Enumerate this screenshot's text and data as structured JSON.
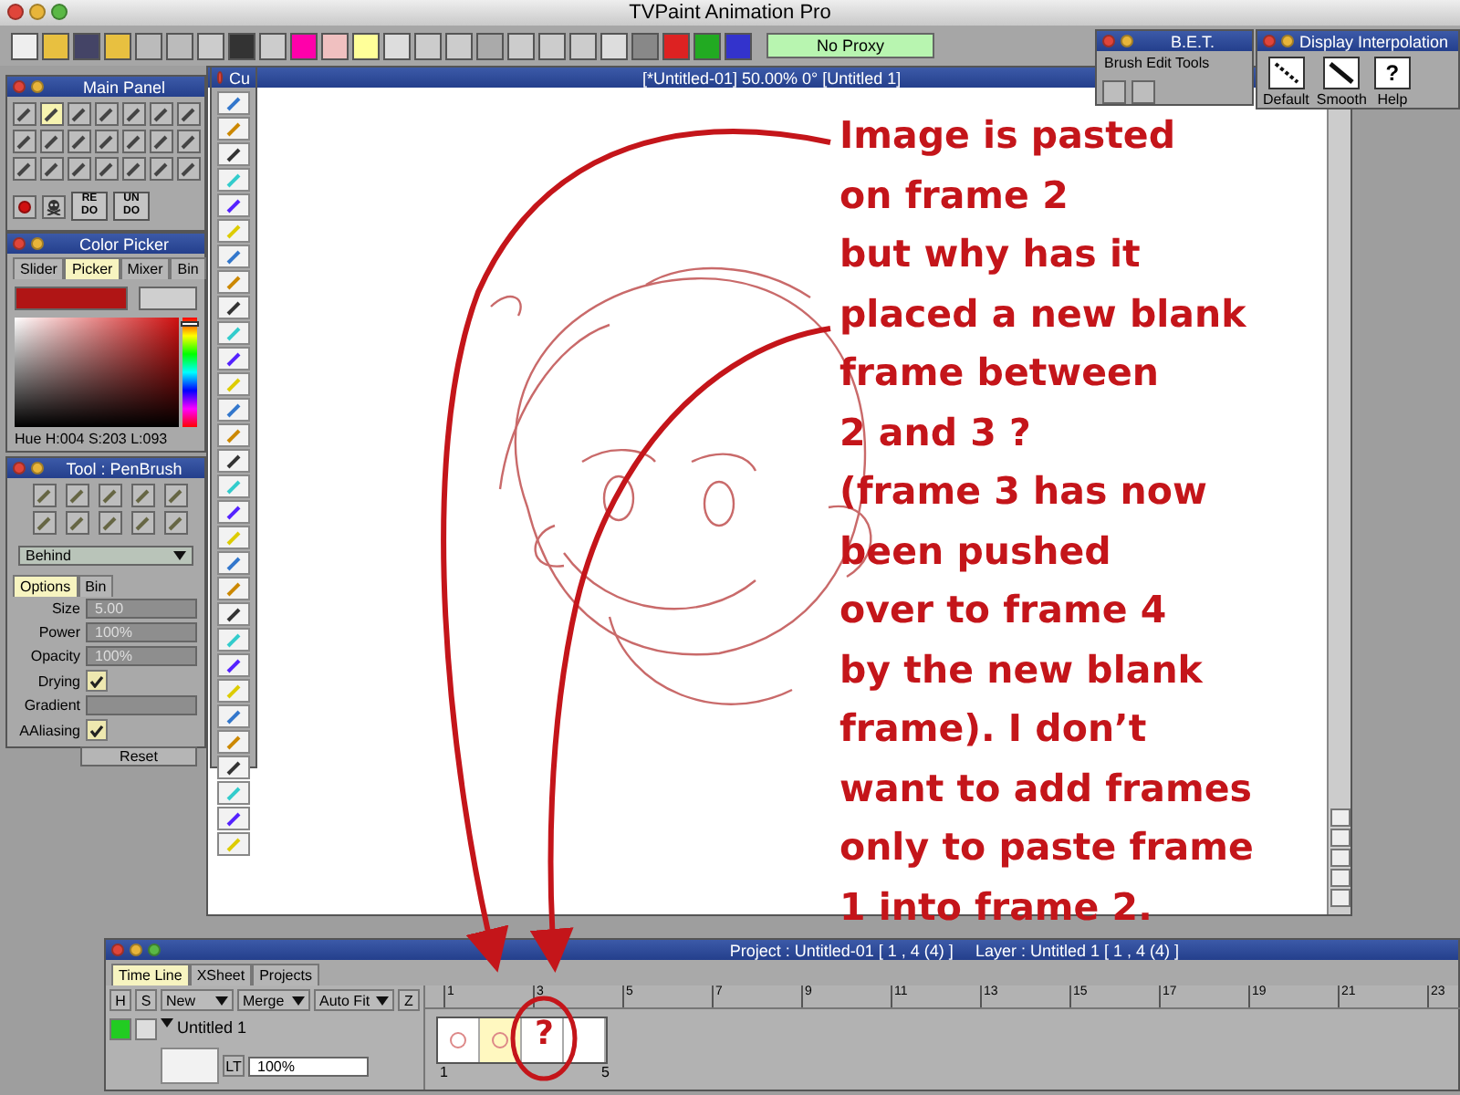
{
  "app_title": "TVPaint Animation Pro",
  "toolbar": {
    "proxy": "No Proxy"
  },
  "canvas_window": {
    "title": "[*Untitled-01]  50.00%  0°  [Untitled 1]"
  },
  "custom_panel": {
    "title": "Cu"
  },
  "main_panel": {
    "title": "Main Panel",
    "tools": [
      {
        "selected": false
      },
      {
        "selected": true
      },
      {
        "selected": false
      },
      {
        "selected": false
      },
      {
        "selected": false
      },
      {
        "selected": false
      },
      {
        "selected": false
      },
      {
        "selected": false
      },
      {
        "selected": false
      },
      {
        "selected": false
      },
      {
        "selected": false
      },
      {
        "selected": false
      },
      {
        "selected": false
      },
      {
        "selected": false
      },
      {
        "selected": false
      },
      {
        "selected": false
      },
      {
        "selected": false
      },
      {
        "selected": false
      },
      {
        "selected": false
      },
      {
        "selected": false
      },
      {
        "selected": false
      }
    ],
    "redo": "RE DO",
    "undo": "UN DO"
  },
  "color_picker": {
    "title": "Color Picker",
    "tabs": [
      {
        "label": "Slider",
        "selected": false
      },
      {
        "label": "Picker",
        "selected": true
      },
      {
        "label": "Mixer",
        "selected": false
      },
      {
        "label": "Bin",
        "selected": false
      }
    ],
    "readout": "Hue H:004 S:203 L:093",
    "hue": {
      "level": 0.03
    }
  },
  "tool_panel": {
    "title": "Tool : PenBrush",
    "mode": "Behind",
    "tabs": [
      {
        "label": "Options",
        "selected": true
      },
      {
        "label": "Bin",
        "selected": false
      }
    ],
    "settings": [
      {
        "kind": "field",
        "label": "Size",
        "value": "5.00"
      },
      {
        "kind": "field",
        "label": "Power",
        "value": "100%"
      },
      {
        "kind": "field",
        "label": "Opacity",
        "value": "100%"
      },
      {
        "kind": "check",
        "label": "Drying",
        "checked": true
      },
      {
        "kind": "bar",
        "label": "Gradient"
      },
      {
        "kind": "check",
        "label": "AAliasing",
        "checked": true
      }
    ],
    "reset": "Reset"
  },
  "bet_panel": {
    "title": "B.E.T.",
    "subtitle": "Brush Edit Tools"
  },
  "interpolation_panel": {
    "title": "Display Interpolation",
    "buttons": [
      {
        "label": "Default",
        "kind": "dashed"
      },
      {
        "label": "Smooth",
        "kind": "solid"
      },
      {
        "label": "Help",
        "kind": "help",
        "glyph": "?"
      }
    ]
  },
  "timeline": {
    "title": "Project : Untitled-01 [ 1 , 4  (4) ]",
    "layer_info": "Layer : Untitled 1 [ 1 , 4  (4) ]",
    "tabs": [
      {
        "label": "Time Line",
        "selected": true
      },
      {
        "label": "XSheet",
        "selected": false
      },
      {
        "label": "Projects",
        "selected": false
      }
    ],
    "columns": [
      "H",
      "S"
    ],
    "dropdowns": [
      "New",
      "Merge",
      "Auto Fit"
    ],
    "z": "Z",
    "layer": {
      "name": "Untitled 1",
      "visible": true,
      "checked": false,
      "lock": "LT",
      "opacity": "100%"
    },
    "ruler": [
      "1",
      "3",
      "5",
      "7",
      "9",
      "11",
      "13",
      "15",
      "17",
      "19",
      "21",
      "23"
    ],
    "frames": [
      {
        "selected": false,
        "drawn": true
      },
      {
        "selected": true,
        "drawn": true
      },
      {
        "selected": false,
        "drawn": false
      },
      {
        "selected": false,
        "drawn": false
      }
    ],
    "frame_labels": [
      "1",
      "5"
    ]
  },
  "annotation": {
    "lines": [
      "Image is pasted",
      "on frame 2",
      "but why has it",
      "placed a new blank",
      "frame between",
      "2 and 3 ?",
      "(frame 3 has now",
      "been pushed",
      "over to frame 4",
      "by the new blank",
      "frame). I don’t",
      "want to add frames",
      "only to paste frame",
      "1 into frame 2."
    ],
    "frame_mark": "?"
  }
}
